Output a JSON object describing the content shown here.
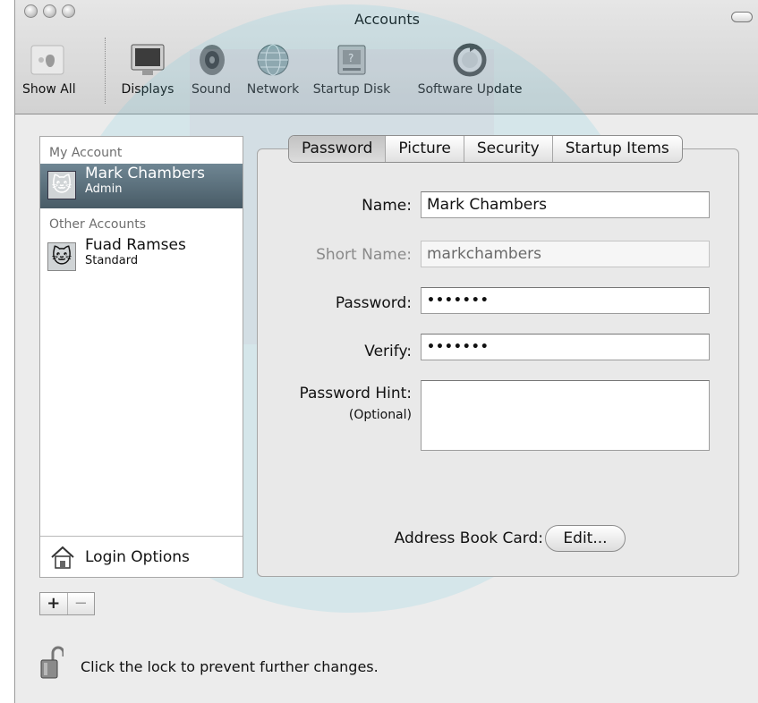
{
  "window": {
    "title": "Accounts"
  },
  "toolbar": {
    "items": [
      {
        "label": "Show All",
        "icon": "apple-grid-icon"
      },
      {
        "label": "Displays",
        "icon": "display-icon"
      },
      {
        "label": "Sound",
        "icon": "speaker-icon"
      },
      {
        "label": "Network",
        "icon": "globe-icon"
      },
      {
        "label": "Startup Disk",
        "icon": "hard-disk-icon"
      },
      {
        "label": "Software Update",
        "icon": "software-update-icon"
      }
    ]
  },
  "sidebar": {
    "my_account_label": "My Account",
    "other_accounts_label": "Other Accounts",
    "accounts": [
      {
        "name": "Mark Chambers",
        "role": "Admin",
        "selected": true
      },
      {
        "name": "Fuad Ramses",
        "role": "Standard",
        "selected": false
      }
    ],
    "login_options_label": "Login Options",
    "add_symbol": "+",
    "remove_symbol": "−"
  },
  "tabs": [
    {
      "label": "Password",
      "active": true
    },
    {
      "label": "Picture",
      "active": false
    },
    {
      "label": "Security",
      "active": false
    },
    {
      "label": "Startup Items",
      "active": false
    }
  ],
  "form": {
    "name_label": "Name:",
    "name_value": "Mark Chambers",
    "short_name_label": "Short Name:",
    "short_name_value": "markchambers",
    "password_label": "Password:",
    "password_value": "•••••••",
    "verify_label": "Verify:",
    "verify_value": "•••••••",
    "hint_label": "Password Hint:",
    "hint_optional": "(Optional)",
    "hint_value": "",
    "address_book_label": "Address Book Card:",
    "edit_button": "Edit..."
  },
  "footer": {
    "lock_text": "Click the lock to prevent further changes."
  },
  "colors": {
    "selection": "#5b707c",
    "chrome": "#d8d8d8",
    "panel": "#e9e9e9"
  }
}
